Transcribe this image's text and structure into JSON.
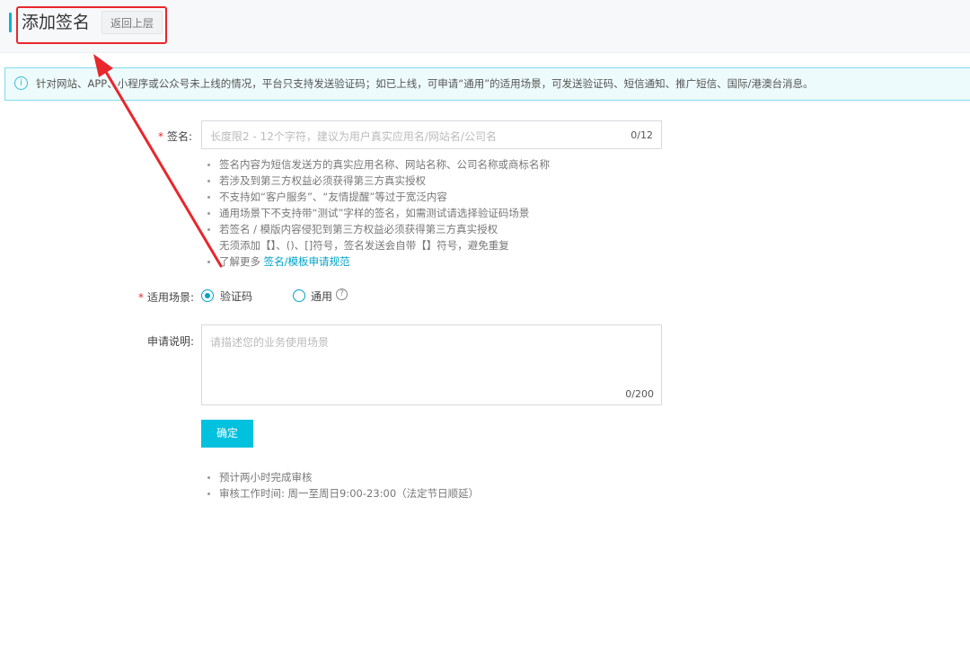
{
  "header": {
    "title": "添加签名",
    "back_label": "返回上层"
  },
  "notice": {
    "icon": "info-icon",
    "icon_glyph": "i",
    "text": "针对网站、APP、小程序或公众号未上线的情况，平台只支持发送验证码；如已上线，可申请“通用”的适用场景，可发送验证码、短信通知、推广短信、国际/港澳台消息。"
  },
  "form": {
    "signature": {
      "required_mark": "*",
      "label": "签名:",
      "placeholder": "长度限2 - 12个字符，建议为用户真实应用名/网站名/公司名",
      "counter": "0/12"
    },
    "tips": [
      "签名内容为短信发送方的真实应用名称、网站名称、公司名称或商标名称",
      "若涉及到第三方权益必须获得第三方真实授权",
      "不支持如“客户服务”、“友情提醒”等过于宽泛内容",
      "通用场景下不支持带“测试”字样的签名，如需测试请选择验证码场景",
      "若签名 / 模版内容侵犯到第三方权益必须获得第三方真实授权",
      "无须添加【】、()、[]符号，签名发送会自带【】符号，避免重复"
    ],
    "learn_more_prefix": "了解更多",
    "learn_more_link": "签名/模板申请规范",
    "scene": {
      "required_mark": "*",
      "label": "适用场景:",
      "options": [
        "验证码",
        "通用"
      ],
      "selected": "验证码",
      "help_glyph": "?"
    },
    "description": {
      "label": "申请说明:",
      "placeholder": "请描述您的业务使用场景",
      "counter": "0/200"
    },
    "submit_label": "确定",
    "footer_tips": [
      "预计两小时完成审核",
      "审核工作时间: 周一至周日9:00-23:00（法定节日顺延）"
    ]
  },
  "annotation": {
    "color": "#e8272c"
  }
}
